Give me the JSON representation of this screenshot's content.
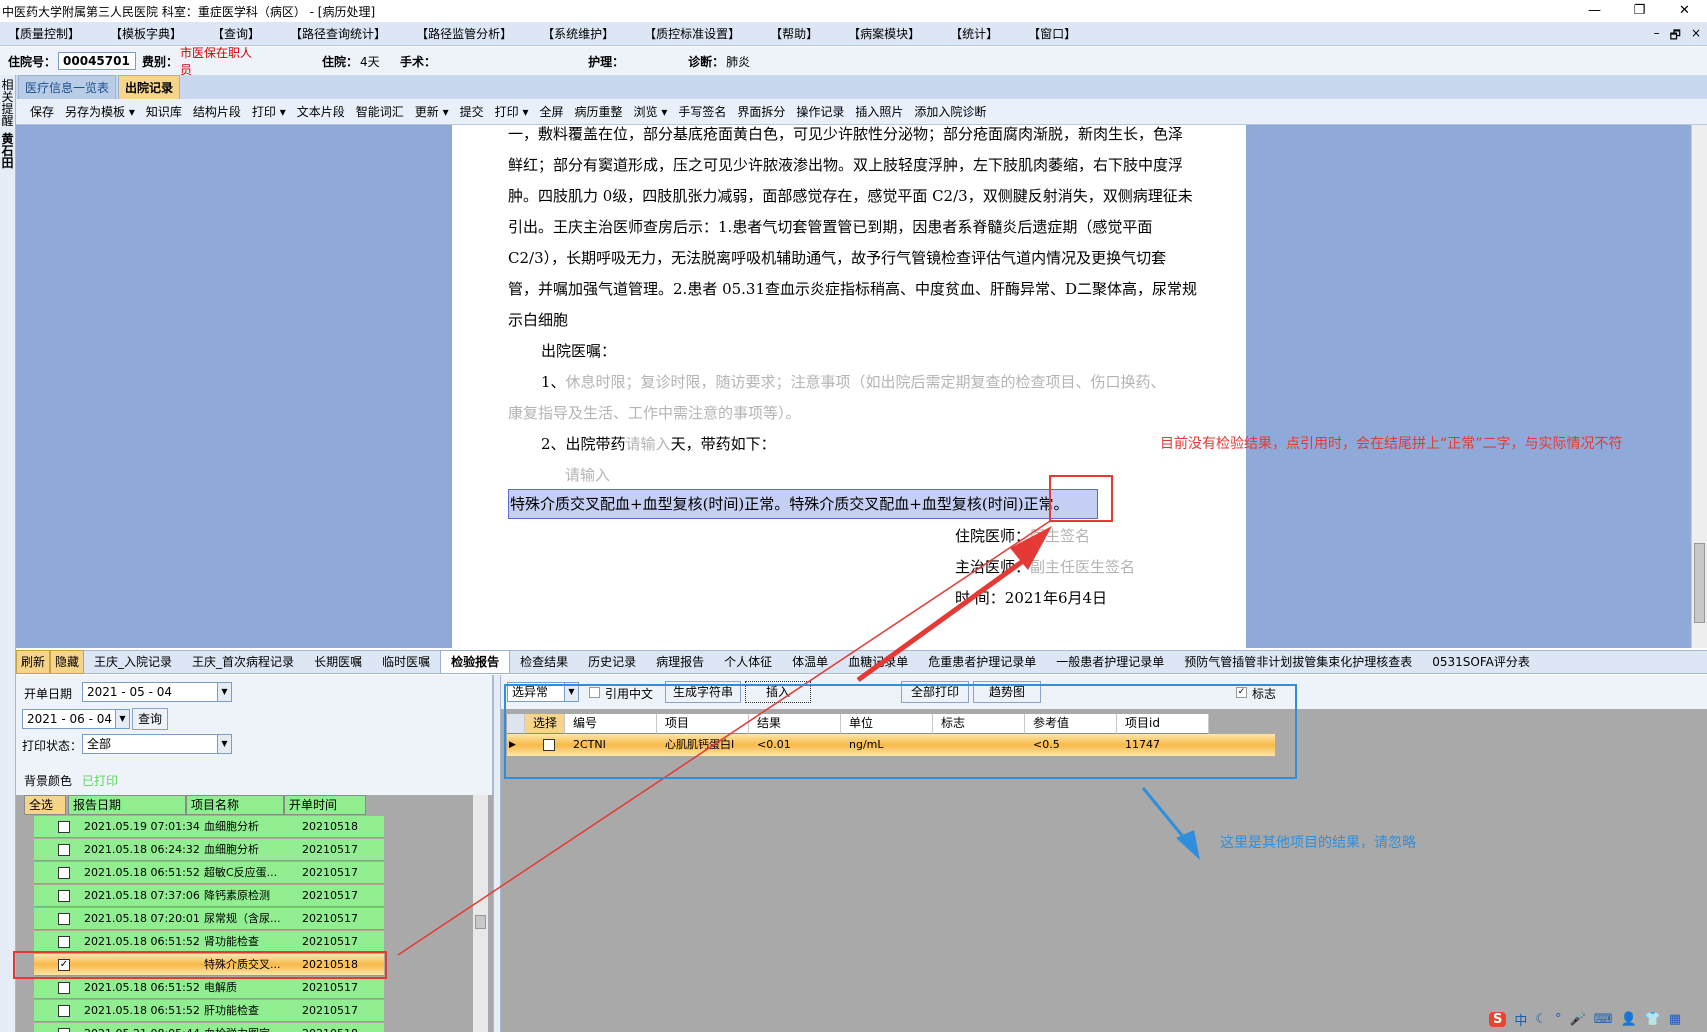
{
  "window": {
    "title": "中医药大学附属第三人民医院  科室：重症医学科（病区） - [病历处理]",
    "controls": [
      "—",
      "❐",
      "✕"
    ]
  },
  "menu": [
    "【质量控制】",
    "【模板字典】",
    "【查询】",
    "【路径查询统计】",
    "【路径监管分析】",
    "【系统维护】",
    "【质控标准设置】",
    "【帮助】",
    "【病案模块】",
    "【统计】",
    "【窗口】"
  ],
  "mdi_controls": [
    "–",
    "🗗",
    "×"
  ],
  "patient": {
    "admission_no_label": "住院号：",
    "admission_no": "00045701",
    "fee_type_label": "费别：",
    "fee_type": "市医保在职人员",
    "stay_label": "住院：",
    "stay": "4天",
    "surgery_label": "手术：",
    "surgery": "",
    "nursing_label": "护理：",
    "nursing": "",
    "diagnosis_label": "诊断：",
    "diagnosis": "肺炎"
  },
  "rail_text": [
    "相",
    "关",
    "提",
    "醒",
    "黄",
    "石",
    "田"
  ],
  "doc_tabs": [
    "医疗信息一览表",
    "出院记录"
  ],
  "toolbar": [
    "保存",
    "另存为模板 ▾",
    "知识库",
    "结构片段",
    "打印 ▾",
    "文本片段",
    "智能词汇",
    "更新 ▾",
    "提交",
    "打印 ▾",
    "全屏",
    "病历重整",
    "浏览 ▾",
    "手写签名",
    "界面拆分",
    "操作记录",
    "插入照片",
    "添加入院诊断"
  ],
  "document": {
    "lines": [
      "一，敷料覆盖在位，部分基底疮面黄白色，可见少许脓性分泌物；部分疮面腐肉渐脱，新肉生长，色泽",
      "鲜红；部分有窦道形成，压之可见少许脓液渗出物。双上肢轻度浮肿，左下肢肌肉萎缩，右下肢中度浮",
      "肿。四肢肌力 0级，四肢肌张力减弱，面部感觉存在，感觉平面 C2/3，双侧腱反射消失，双侧病理征未",
      "引出。王庆主治医师查房后示：1.患者气切套管置管已到期，因患者系脊髓炎后遗症期（感觉平面",
      "C2/3），长期呼吸无力，无法脱离呼吸机辅助通气，故予行气管镜检查评估气道内情况及更换气切套",
      "管，并嘱加强气道管理。2.患者 05.31查血示炎症指标稍高、中度贫血、肝酶异常、D二聚体高，尿常规",
      "示白细胞"
    ],
    "discharge_orders_label": "出院医嘱：",
    "order1_prefix": "1、",
    "order1_text": "休息时限；复诊时限，随访要求；注意事项（如出院后需定期复查的检查项目、伤口换药、",
    "order1_text2": "康复指导及生活、工作中需注意的事项等）。",
    "order2_prefix": "2、出院带药",
    "order2_placeholder": "请输入",
    "order2_suffix": "天，带药如下：",
    "input_placeholder": "请输入",
    "selected_text": "特殊介质交叉配血+血型复核(时间)正常。特殊介质交叉配血+血型复核(时间)正常。",
    "resident_label": "住院医师：",
    "resident_value": "医生签名",
    "attending_label": "主治医师：",
    "attending_value": "副主任医生签名",
    "time_label": "时    间：",
    "time_value": "2021年6月4日"
  },
  "annotations": {
    "red_note": "目前没有检验结果，点引用时，会在结尾拼上“正常”二字，与实际情况不符",
    "blue_note": "这里是其他项目的结果，请忽略"
  },
  "bottom_tabs": [
    "刷新",
    "隐藏",
    "王庆_入院记录",
    "王庆_首次病程记录",
    "长期医嘱",
    "临时医嘱",
    "检验报告",
    "检查结果",
    "历史记录",
    "病理报告",
    "个人体征",
    "体温单",
    "血糖记录单",
    "危重患者护理记录单",
    "一般患者护理记录单",
    "预防气管插管非计划拔管集束化护理核查表",
    "0531SOFA评分表"
  ],
  "filters": {
    "start_label": "开单日期",
    "start_date": "2021 - 05 - 04",
    "end_date": "2021 - 06 - 04",
    "query_button": "查询",
    "print_status_label": "打印状态：",
    "print_status": "全部",
    "bg_color_label": "背景颜色",
    "printed_label": "已打印"
  },
  "left_grid": {
    "headers": [
      "全选",
      "报告日期",
      "项目名称",
      "开单时间"
    ],
    "rows": [
      {
        "checked": false,
        "date": "2021.05.19 07:01:34",
        "name": "血细胞分析",
        "order": "20210518"
      },
      {
        "checked": false,
        "date": "2021.05.18 06:24:32",
        "name": "血细胞分析",
        "order": "20210517"
      },
      {
        "checked": false,
        "date": "2021.05.18 06:51:52",
        "name": "超敏C反应蛋...",
        "order": "20210517"
      },
      {
        "checked": false,
        "date": "2021.05.18 07:37:06",
        "name": "降钙素原检测",
        "order": "20210517"
      },
      {
        "checked": false,
        "date": "2021.05.18 07:20:01",
        "name": "尿常规（含尿...",
        "order": "20210517"
      },
      {
        "checked": false,
        "date": "2021.05.18 06:51:52",
        "name": "肾功能检查",
        "order": "20210517"
      },
      {
        "checked": true,
        "date": "",
        "name": "特殊介质交叉...",
        "order": "20210518"
      },
      {
        "checked": false,
        "date": "2021.05.18 06:51:52",
        "name": "电解质",
        "order": "20210517"
      },
      {
        "checked": false,
        "date": "2021.05.18 06:51:52",
        "name": "肝功能检查",
        "order": "20210517"
      },
      {
        "checked": false,
        "date": "2021.05.21 08:05:44",
        "name": "血栓弹力图定...",
        "order": "20210518"
      }
    ]
  },
  "right_tool": {
    "filter_select": "选异常",
    "cite_cn_label": "引用中文",
    "gen_string": "生成字符串",
    "insert": "插入",
    "print_all": "全部打印",
    "trend": "趋势图",
    "flag_label": "标志"
  },
  "right_grid": {
    "headers": [
      "选择",
      "编号",
      "项目",
      "结果",
      "单位",
      "标志",
      "参考值",
      "项目id"
    ],
    "rows": [
      {
        "code": "2CTNI",
        "item": "心肌肌钙蛋白I",
        "result": "<0.01",
        "unit": "ng/mL",
        "flag": "",
        "ref": "<0.5",
        "id": "11747"
      }
    ]
  },
  "tray": [
    "S",
    "中",
    "☾",
    "°",
    "🎤",
    "⌨",
    "👤",
    "👕",
    "▦"
  ]
}
